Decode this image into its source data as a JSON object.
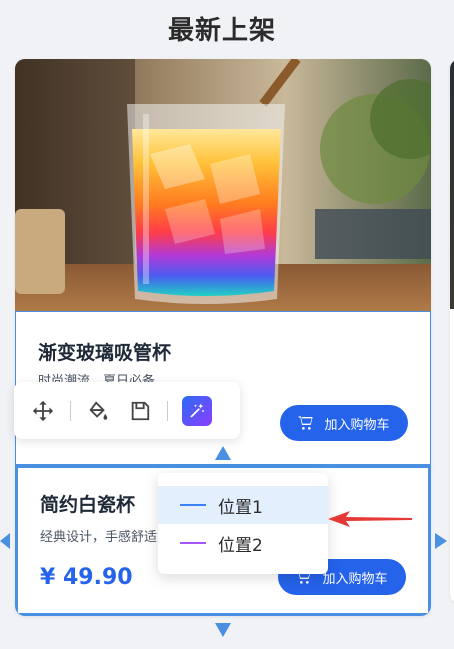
{
  "page": {
    "title": "最新上架"
  },
  "products": [
    {
      "name": "渐变玻璃吸管杯",
      "desc": "时尚潮流，夏日必备",
      "cart_label": "加入购物车"
    },
    {
      "name": "简约白瓷杯",
      "desc": "经典设计，手感舒适",
      "price": "¥ 49.90",
      "cart_label": "加入购物车"
    }
  ],
  "toolbar": {
    "tools": [
      "move-icon",
      "fill-bucket-icon",
      "save-icon",
      "magic-wand-icon"
    ]
  },
  "dropdown": {
    "items": [
      {
        "label": "位置1",
        "color": "#3b82f6",
        "selected": true
      },
      {
        "label": "位置2",
        "color": "#a855f7",
        "selected": false
      }
    ]
  },
  "colors": {
    "accent": "#2563eb",
    "selection_border": "#4a90e2",
    "pointer_arrow": "#e53935"
  }
}
